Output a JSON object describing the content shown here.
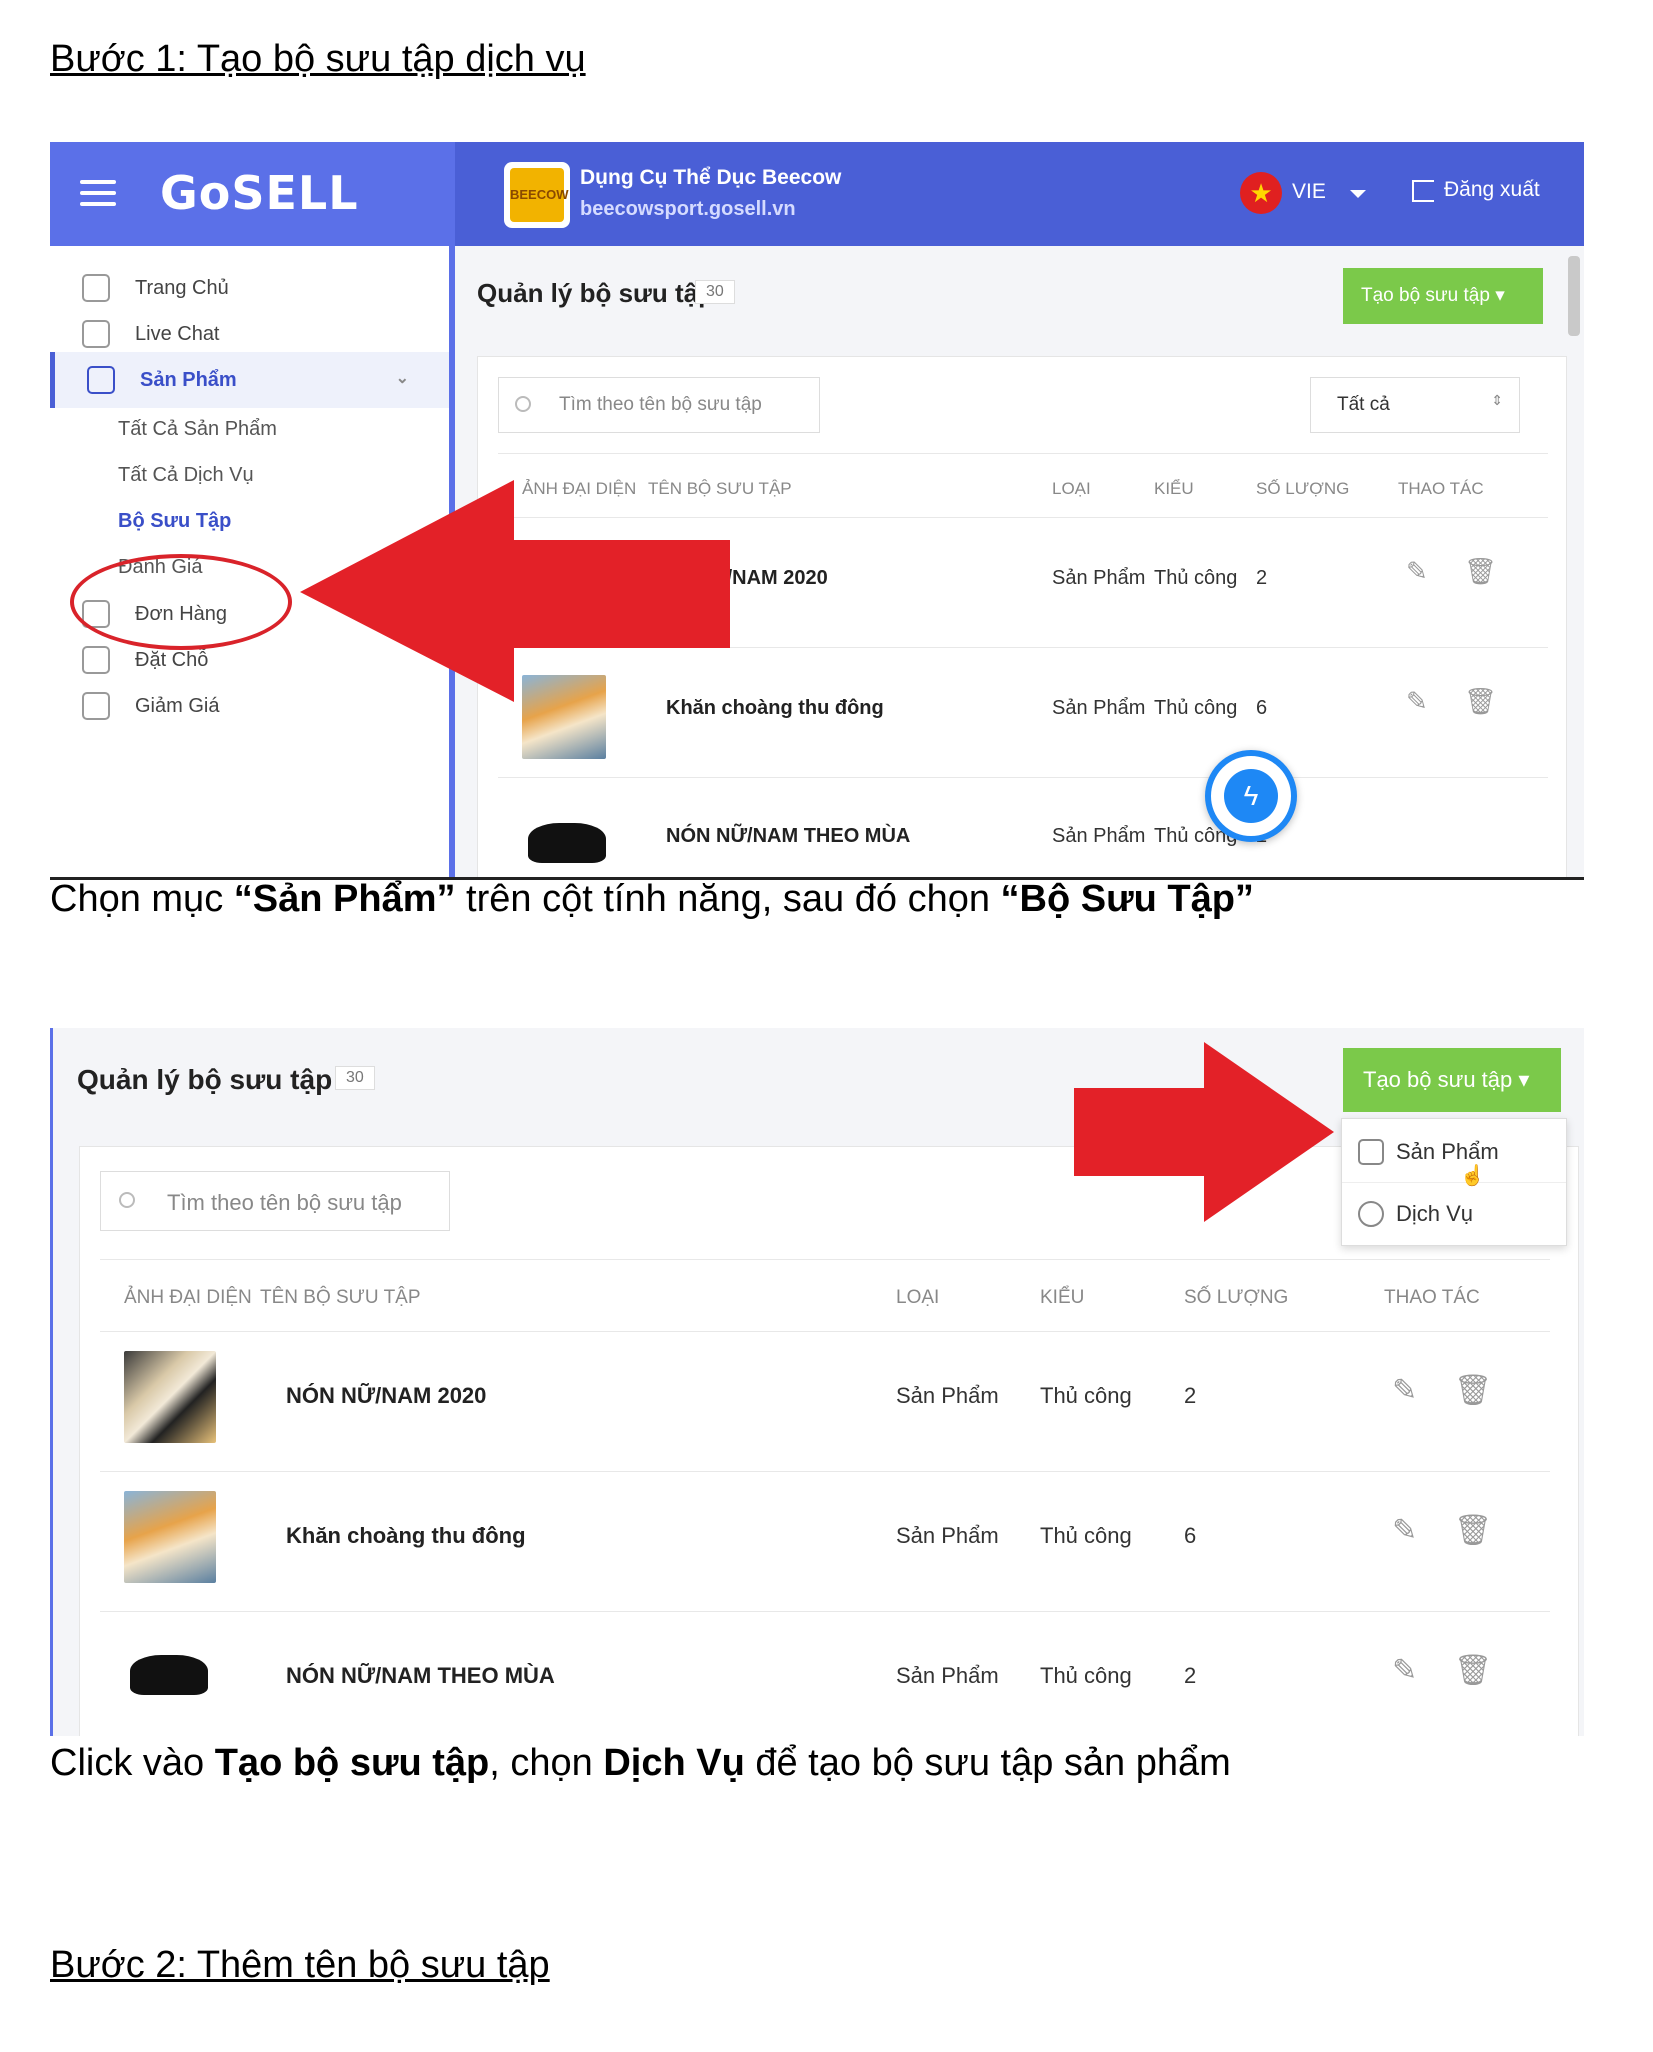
{
  "step1": {
    "heading": "Bước 1: Tạo bộ sưu tập dịch vụ",
    "caption": {
      "p1": "Chọn mục ",
      "b1": "“Sản Phẩm”",
      "p2": " trên cột tính năng, sau đó chọn ",
      "b2": "“Bộ Sưu Tập”"
    }
  },
  "app": {
    "logo": "GoSELL",
    "shop_name": "Dụng Cụ Thể Dục Beecow",
    "shop_url": "beecowsport.gosell.vn",
    "shop_avatar_text": "BEECOW",
    "language": "VIE",
    "logout": "Đăng xuất",
    "colors": {
      "header": "#4a5fd6",
      "accent": "#3a4fc8",
      "create_button": "#7bc94a",
      "arrow": "#e32128"
    }
  },
  "sidebar": {
    "items": [
      {
        "label": "Trang Chủ",
        "icon": "home-icon"
      },
      {
        "label": "Live Chat",
        "icon": "chat-icon"
      },
      {
        "label": "Sản Phẩm",
        "icon": "tag-icon"
      },
      {
        "label": "Đơn Hàng",
        "icon": "receipt-icon"
      },
      {
        "label": "Đặt Chỗ",
        "icon": "calendar-icon"
      },
      {
        "label": "Giảm Giá",
        "icon": "discount-icon"
      }
    ],
    "sub_items": [
      "Tất Cả Sản Phẩm",
      "Tất Cả Dịch Vụ",
      "Bộ Sưu Tập",
      "Đánh Giá"
    ]
  },
  "collections": {
    "title": "Quản lý bộ sưu tập",
    "count": "30",
    "create_button": "Tạo bộ sưu tập",
    "search_placeholder": "Tìm theo tên bộ sưu tập",
    "filter_value": "Tất cả",
    "columns": [
      "ẢNH ĐẠI DIỆN",
      "TÊN BỘ SƯU TẬP",
      "LOẠI",
      "KIỂU",
      "SỐ LƯỢNG",
      "THAO TÁC"
    ],
    "rows": [
      {
        "name": "NÓN NỮ/NAM 2020",
        "name_partial": "Ữ/NAM 2020",
        "type": "Sản Phẩm",
        "kind": "Thủ công",
        "qty": "2"
      },
      {
        "name": "Khăn choàng thu đông",
        "type": "Sản Phẩm",
        "kind": "Thủ công",
        "qty": "6"
      },
      {
        "name": "NÓN NỮ/NAM THEO MÙA",
        "type": "Sản Phẩm",
        "kind": "Thủ công",
        "qty": "2"
      }
    ],
    "dropdown": [
      {
        "label": "Sản Phẩm",
        "icon": "tag-icon"
      },
      {
        "label": "Dịch Vụ",
        "icon": "flower-icon"
      }
    ]
  },
  "step1b": {
    "caption": {
      "p1": "Click vào ",
      "b1": "Tạo bộ sưu tập",
      "p2": ", chọn ",
      "b2": "Dịch Vụ",
      "p3": " để tạo bộ sưu tập sản phẩm"
    }
  },
  "step2": {
    "heading": "Bước 2: Thêm tên bộ sưu tập"
  }
}
